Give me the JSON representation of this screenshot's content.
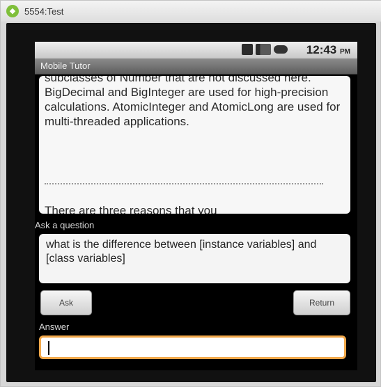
{
  "window": {
    "title": "5554:Test",
    "title_icon": "android-icon"
  },
  "status_bar": {
    "time": "12:43",
    "ampm": "PM",
    "icons": [
      "network-icon",
      "signal-icon",
      "battery-icon"
    ]
  },
  "app": {
    "title": "Mobile Tutor"
  },
  "content": {
    "text": "subclasses of Number that are not discussed here. BigDecimal and BigInteger are used for high-precision calculations. AtomicInteger and AtomicLong are used for multi-threaded applications.",
    "tail": "There are three reasons that you"
  },
  "ask": {
    "label": "Ask a question",
    "question": "what is the difference between [instance variables] and [class variables]",
    "ask_button": "Ask",
    "return_button": "Return"
  },
  "answer": {
    "label": "Answer",
    "value": ""
  },
  "colors": {
    "focus_border": "#f2a84a",
    "screen_background": "#000000"
  }
}
